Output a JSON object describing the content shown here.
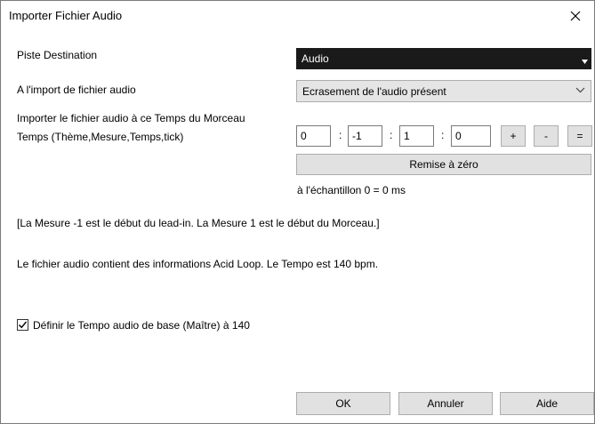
{
  "window": {
    "title": "Importer Fichier Audio"
  },
  "dest": {
    "label": "Piste Destination",
    "value": "Audio"
  },
  "import_mode": {
    "label": "A l'import de fichier audio",
    "value": "Ecrasement de l'audio présent"
  },
  "position": {
    "heading": "Importer le fichier audio à ce Temps du Morceau",
    "label": "Temps (Thème,Mesure,Temps,tick)",
    "fields": [
      "0",
      "-1",
      "1",
      "0"
    ],
    "separator": ":",
    "plus": "+",
    "minus": "-",
    "equals": "=",
    "reset": "Remise à zéro",
    "sample_text": "à l'échantillon 0 = 0 ms"
  },
  "info": {
    "bar_note": "[La Mesure -1 est le début du lead-in. La Mesure 1 est le début du Morceau.]",
    "acid_note": "Le fichier audio contient des informations Acid Loop. Le Tempo est 140 bpm."
  },
  "master_tempo": {
    "label": "Définir le Tempo audio de base (Maître) à 140",
    "checked": true
  },
  "buttons": {
    "ok": "OK",
    "cancel": "Annuler",
    "help": "Aide"
  }
}
